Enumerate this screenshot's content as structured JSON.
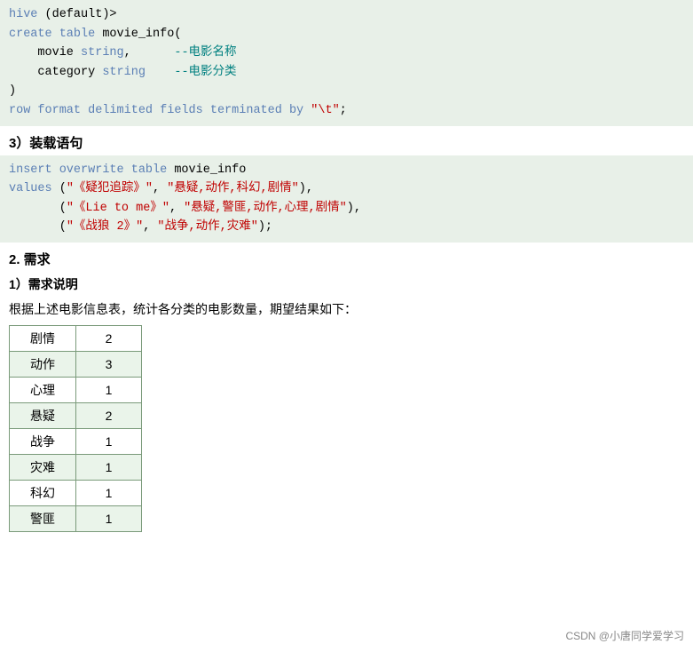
{
  "code_block1": {
    "lines": [
      "hive (default)>",
      "create table movie_info(",
      "    movie string,      --电影名称",
      "    category string    --电影分类",
      ")",
      "row format delimited fields terminated by \"\\t\";"
    ]
  },
  "section2_heading": "3）装载语句",
  "code_block2": {
    "lines": [
      "insert overwrite table movie_info",
      "values (\"《疑犯追踪》\", \"悬疑,动作,科幻,剧情\"),",
      "       (\"《Lie to me》\", \"悬疑,警匪,动作,心理,剧情\"),",
      "       (\"《战狼 2》\", \"战争,动作,灾难\");"
    ]
  },
  "section3_heading": "2. 需求",
  "sub_heading1": "1）需求说明",
  "description": "根据上述电影信息表，统计各分类的电影数量，期望结果如下：",
  "table": {
    "rows": [
      {
        "category": "剧情",
        "count": "2"
      },
      {
        "category": "动作",
        "count": "3"
      },
      {
        "category": "心理",
        "count": "1"
      },
      {
        "category": "悬疑",
        "count": "2"
      },
      {
        "category": "战争",
        "count": "1"
      },
      {
        "category": "灾难",
        "count": "1"
      },
      {
        "category": "科幻",
        "count": "1"
      },
      {
        "category": "警匪",
        "count": "1"
      }
    ]
  },
  "watermark": "CSDN @小唐同学爱学习"
}
